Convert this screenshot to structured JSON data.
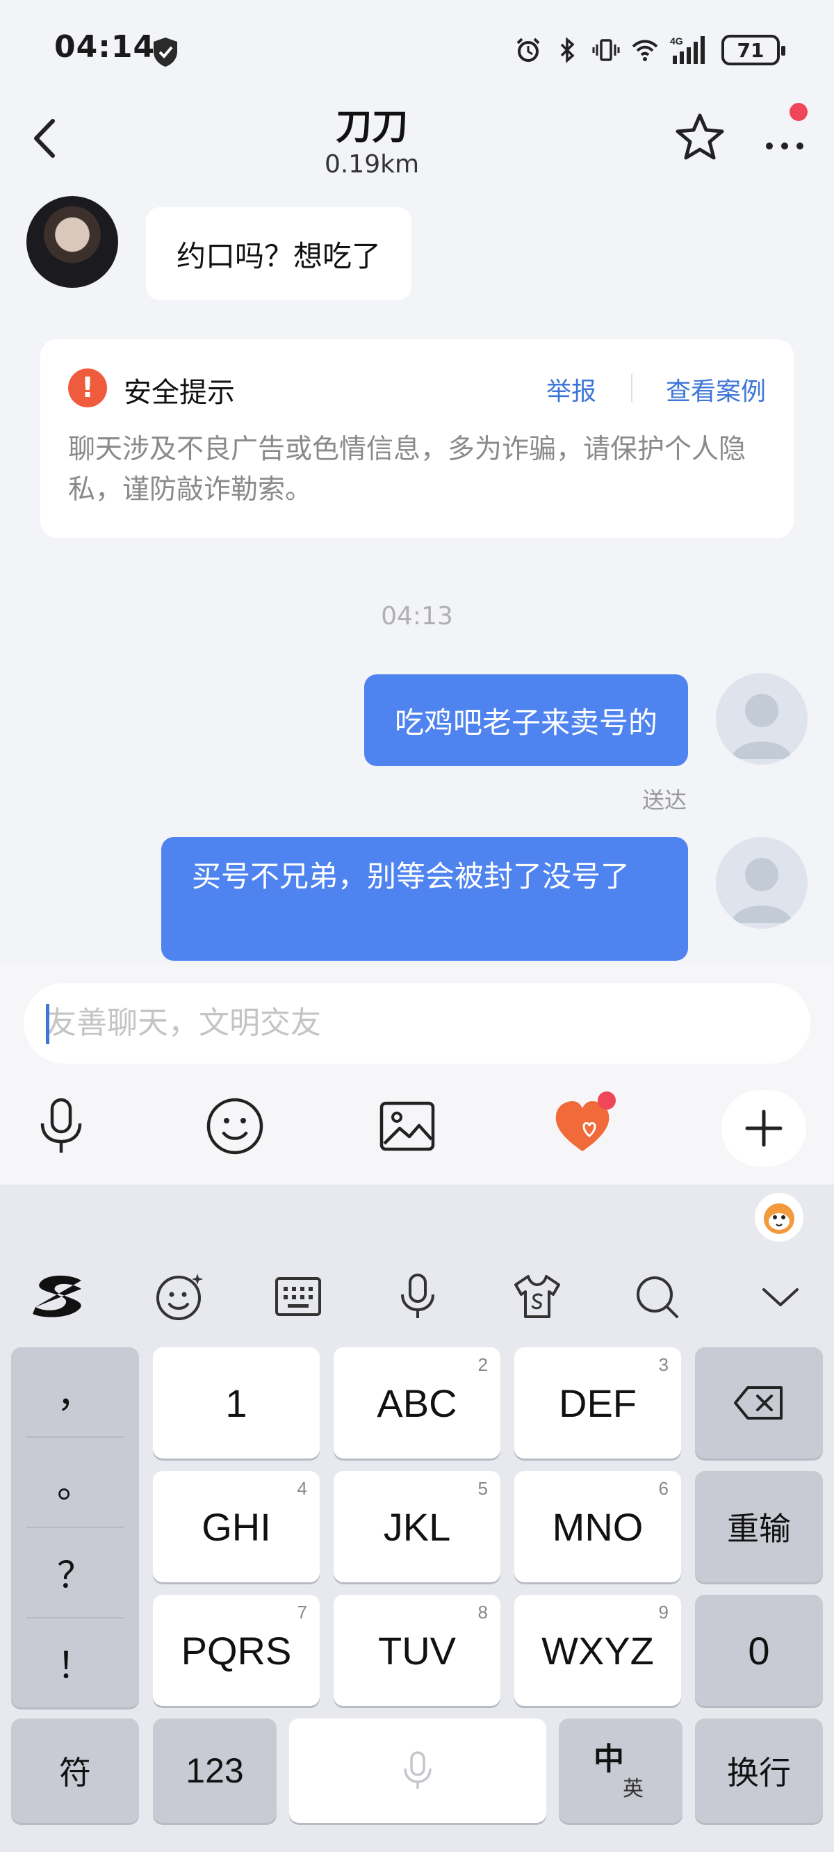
{
  "status_bar": {
    "time": "04:14",
    "network": "4G",
    "battery": "71"
  },
  "header": {
    "title": "刀刀",
    "distance": "0.19km"
  },
  "messages": {
    "incoming_1": "约口吗？想吃了",
    "timestamp": "04:13",
    "outgoing_1": "吃鸡吧老子来卖号的",
    "outgoing_1_status": "送达",
    "outgoing_2": "买号不兄弟，别等会被封了没号了"
  },
  "safety_notice": {
    "title": "安全提示",
    "report_label": "举报",
    "view_cases_label": "查看案例",
    "text": "聊天涉及不良广告或色情信息，多为诈骗，请保护个人隐私，谨防敲诈勒索。"
  },
  "input": {
    "placeholder": "友善聊天，文明交友"
  },
  "keyboard": {
    "punctuation": [
      "，",
      "。",
      "？",
      "！"
    ],
    "rows": [
      [
        {
          "label": "1",
          "sub": ""
        },
        {
          "label": "ABC",
          "sub": "2"
        },
        {
          "label": "DEF",
          "sub": "3"
        }
      ],
      [
        {
          "label": "GHI",
          "sub": "4"
        },
        {
          "label": "JKL",
          "sub": "5"
        },
        {
          "label": "MNO",
          "sub": "6"
        }
      ],
      [
        {
          "label": "PQRS",
          "sub": "7"
        },
        {
          "label": "TUV",
          "sub": "8"
        },
        {
          "label": "WXYZ",
          "sub": "9"
        }
      ]
    ],
    "reenter_label": "重输",
    "zero_label": "0",
    "symbols_label": "符",
    "numbers_label": "123",
    "lang_main": "中",
    "lang_alt": "英",
    "newline_label": "换行"
  }
}
